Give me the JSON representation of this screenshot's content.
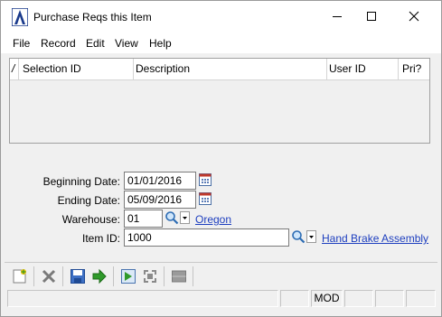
{
  "window": {
    "title": "Purchase Reqs this Item"
  },
  "menu": [
    "File",
    "Record",
    "Edit",
    "View",
    "Help"
  ],
  "grid": {
    "marker": "/",
    "columns": [
      "Selection ID",
      "Description",
      "User ID",
      "Pri?"
    ]
  },
  "form": {
    "beginning_date": {
      "label": "Beginning Date:",
      "value": "01/01/2016"
    },
    "ending_date": {
      "label": "Ending Date:",
      "value": "05/09/2016"
    },
    "warehouse": {
      "label": "Warehouse:",
      "value": "01",
      "link": "Oregon"
    },
    "item_id": {
      "label": "Item ID:",
      "value": "1000",
      "link": "Hand Brake Assembly"
    }
  },
  "status": {
    "mode": "MOD"
  },
  "colors": {
    "link": "#1e3fbf",
    "accent": "#1a3a8c"
  }
}
